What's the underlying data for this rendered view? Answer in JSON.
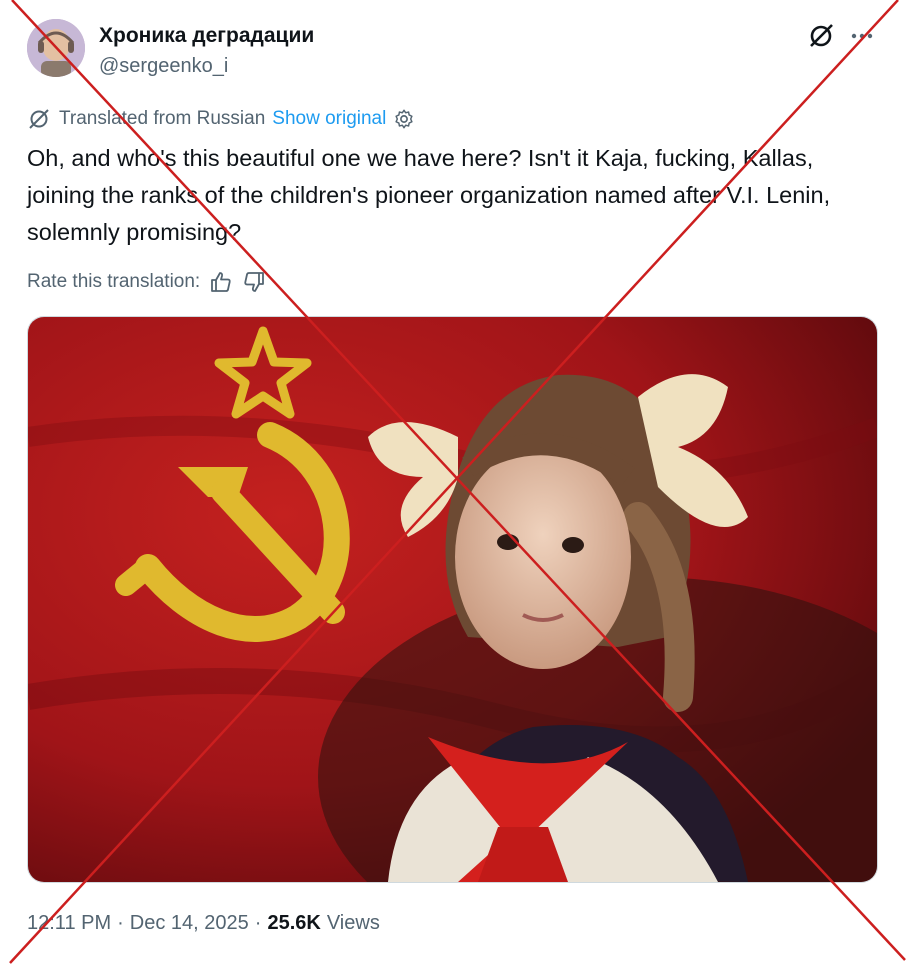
{
  "author": {
    "display_name": "Хроника деградации",
    "handle": "@sergeenko_i"
  },
  "icons": {
    "avatar": "avatar-photo",
    "grok": "grok-icon",
    "more": "more-dots-icon",
    "translate": "translate-icon",
    "settings": "gear-icon",
    "thumbs_up": "thumbs-up-icon",
    "thumbs_down": "thumbs-down-icon"
  },
  "translation": {
    "label": "Translated from Russian",
    "show_original": "Show original"
  },
  "tweet": {
    "text": "Oh, and who's this beautiful one we have here? Isn't it Kaja, fucking, Kallas, joining the ranks of the children's pioneer organization named after V.I. Lenin, solemnly promising?"
  },
  "rating": {
    "label": "Rate this translation:"
  },
  "meta": {
    "time": "12:11 PM",
    "separator": "·",
    "date": "Dec 14, 2025",
    "views_count": "25.6K",
    "views_label": "Views"
  },
  "colors": {
    "text_primary": "#0f1419",
    "text_secondary": "#536471",
    "link": "#1d9bf0",
    "cross_overlay": "#cc1f1f",
    "flag_red": "#b5161a",
    "emblem_gold": "#e0b92e"
  }
}
